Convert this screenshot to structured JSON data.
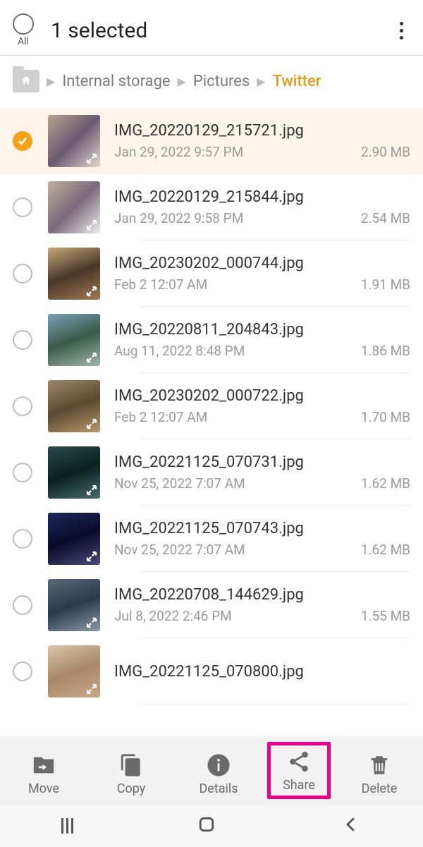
{
  "header": {
    "title": "1 selected",
    "allLabel": "All"
  },
  "breadcrumb": {
    "items": [
      "Internal storage",
      "Pictures",
      "Twitter"
    ]
  },
  "files": [
    {
      "name": "IMG_20220129_215721.jpg",
      "date": "Jan 29, 2022 9:57 PM",
      "size": "2.90 MB",
      "selected": true,
      "thumbClass": "th1"
    },
    {
      "name": "IMG_20220129_215844.jpg",
      "date": "Jan 29, 2022 9:58 PM",
      "size": "2.54 MB",
      "selected": false,
      "thumbClass": "th2"
    },
    {
      "name": "IMG_20230202_000744.jpg",
      "date": "Feb 2 12:07 AM",
      "size": "1.91 MB",
      "selected": false,
      "thumbClass": "th3"
    },
    {
      "name": "IMG_20220811_204843.jpg",
      "date": "Aug 11, 2022 8:48 PM",
      "size": "1.86 MB",
      "selected": false,
      "thumbClass": "th4"
    },
    {
      "name": "IMG_20230202_000722.jpg",
      "date": "Feb 2 12:07 AM",
      "size": "1.70 MB",
      "selected": false,
      "thumbClass": "th5"
    },
    {
      "name": "IMG_20221125_070731.jpg",
      "date": "Nov 25, 2022 7:07 AM",
      "size": "1.62 MB",
      "selected": false,
      "thumbClass": "th6"
    },
    {
      "name": "IMG_20221125_070743.jpg",
      "date": "Nov 25, 2022 7:07 AM",
      "size": "1.62 MB",
      "selected": false,
      "thumbClass": "th7"
    },
    {
      "name": "IMG_20220708_144629.jpg",
      "date": "Jul 8, 2022 2:46 PM",
      "size": "1.55 MB",
      "selected": false,
      "thumbClass": "th8"
    },
    {
      "name": "IMG_20221125_070800.jpg",
      "date": "",
      "size": "",
      "selected": false,
      "thumbClass": "th9"
    }
  ],
  "actions": {
    "move": "Move",
    "copy": "Copy",
    "details": "Details",
    "share": "Share",
    "delete": "Delete"
  }
}
